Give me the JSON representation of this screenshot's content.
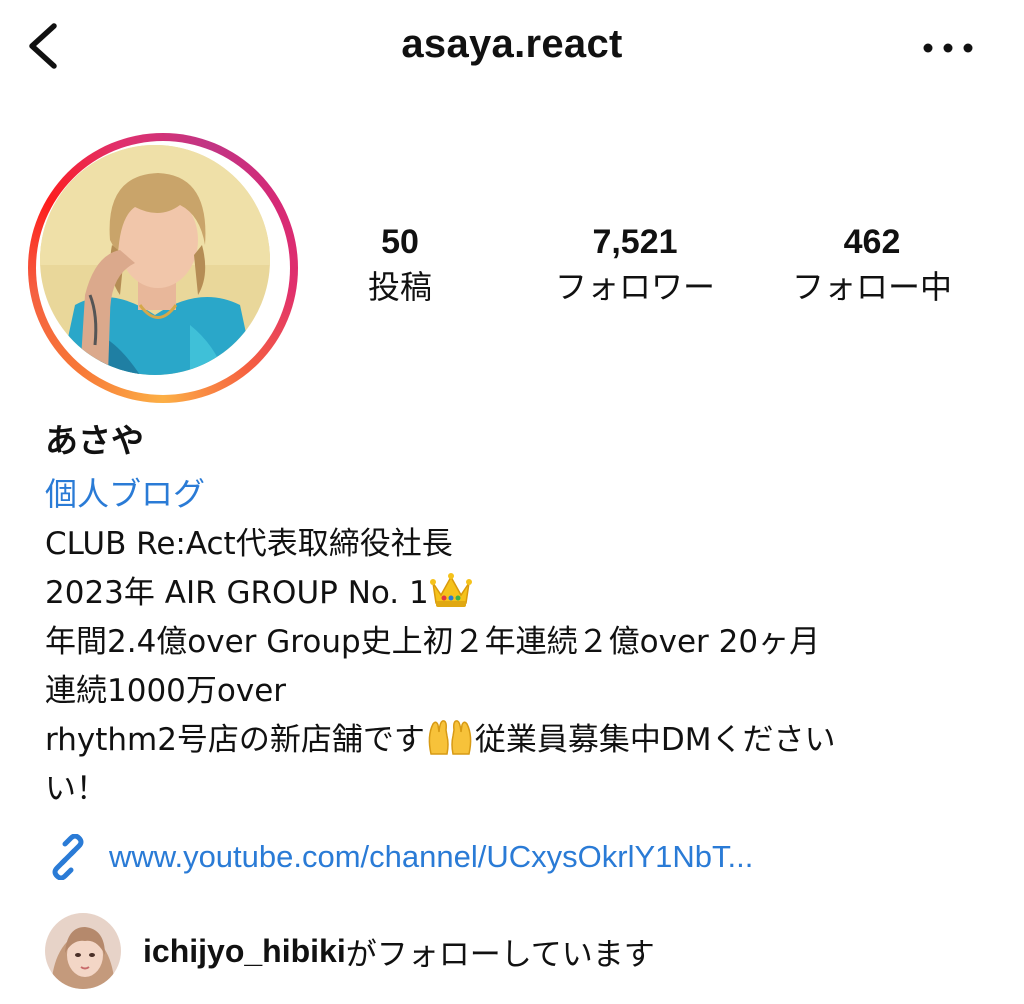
{
  "header": {
    "username": "asaya.react",
    "back_icon": "chevron-left-icon",
    "more_icon": "more-horizontal-icon"
  },
  "profile": {
    "avatar": "profile-photo",
    "story_ring_colors": [
      "#fcaf45",
      "#f77737",
      "#fd1d1d",
      "#e1306c",
      "#c13584"
    ]
  },
  "stats": {
    "posts": {
      "value": "50",
      "label": "投稿"
    },
    "followers": {
      "value": "7,521",
      "label": "フォロワー"
    },
    "following": {
      "value": "462",
      "label": "フォロー中"
    }
  },
  "bio": {
    "name": "あさや",
    "category_link": "個人ブログ",
    "lines": [
      "CLUB Re:Act代表取締役社長",
      "2023年 AIR GROUP No. 1",
      "年間2.4億over Group史上初２年連続２億over 20ヶ月",
      "連続1000万over",
      "rhythm2号店の新店舗です",
      "従業員募集中DMください",
      "い！"
    ],
    "emojis": [
      "crown",
      "raising-hands"
    ]
  },
  "website": {
    "icon": "link-icon",
    "url": "www.youtube.com/channel/UCxysOkrlY1NbT..."
  },
  "followed_by": {
    "username": "ichijyo_hibiki",
    "text": "がフォローしています"
  },
  "colors": {
    "link": "#2a7bd6",
    "text": "#111111",
    "background": "#ffffff"
  }
}
